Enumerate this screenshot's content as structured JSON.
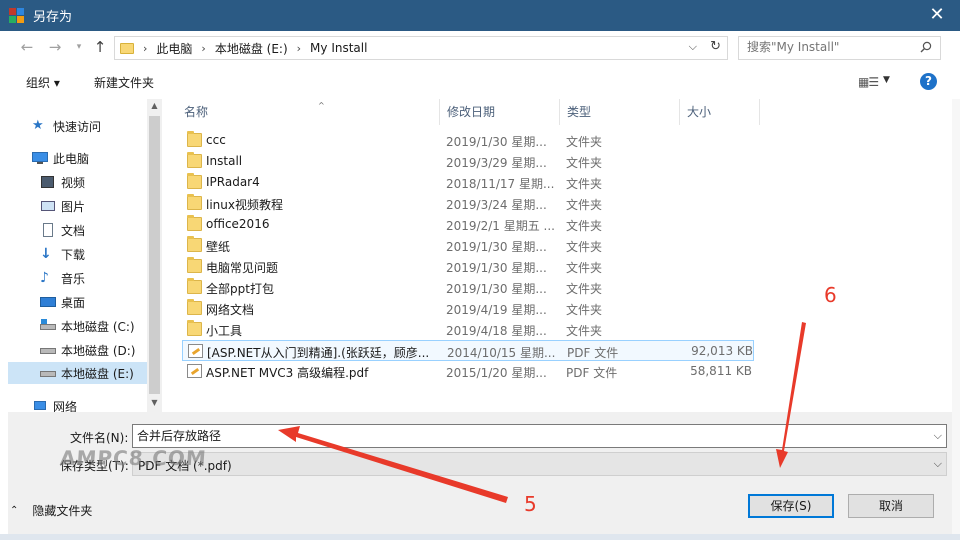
{
  "window": {
    "title": "另存为"
  },
  "address": {
    "crumbs": [
      "此电脑",
      "本地磁盘 (E:)",
      "My Install"
    ],
    "search_placeholder": "搜索\"My Install\""
  },
  "toolbar": {
    "organize": "组织 ▾",
    "new_folder": "新建文件夹"
  },
  "nav": {
    "items": [
      {
        "label": "快速访问",
        "icon": "star-icon"
      },
      {
        "label": "此电脑",
        "icon": "computer-icon"
      },
      {
        "label": "视频",
        "icon": "video-icon"
      },
      {
        "label": "图片",
        "icon": "picture-icon"
      },
      {
        "label": "文档",
        "icon": "document-icon"
      },
      {
        "label": "下载",
        "icon": "download-icon"
      },
      {
        "label": "音乐",
        "icon": "music-icon"
      },
      {
        "label": "桌面",
        "icon": "desktop-icon"
      },
      {
        "label": "本地磁盘 (C:)",
        "icon": "drive-icon"
      },
      {
        "label": "本地磁盘 (D:)",
        "icon": "drive-icon"
      },
      {
        "label": "本地磁盘 (E:)",
        "icon": "drive-icon"
      },
      {
        "label": "网络",
        "icon": "network-icon"
      }
    ]
  },
  "columns": {
    "name": "名称",
    "date": "修改日期",
    "type": "类型",
    "size": "大小"
  },
  "files": [
    {
      "name": "ccc",
      "date": "2019/1/30 星期...",
      "type": "文件夹",
      "size": "",
      "kind": "folder"
    },
    {
      "name": "Install",
      "date": "2019/3/29 星期...",
      "type": "文件夹",
      "size": "",
      "kind": "folder"
    },
    {
      "name": "IPRadar4",
      "date": "2018/11/17 星期...",
      "type": "文件夹",
      "size": "",
      "kind": "folder"
    },
    {
      "name": "linux视频教程",
      "date": "2019/3/24 星期...",
      "type": "文件夹",
      "size": "",
      "kind": "folder"
    },
    {
      "name": "office2016",
      "date": "2019/2/1 星期五 ...",
      "type": "文件夹",
      "size": "",
      "kind": "folder"
    },
    {
      "name": "壁纸",
      "date": "2019/1/30 星期...",
      "type": "文件夹",
      "size": "",
      "kind": "folder"
    },
    {
      "name": "电脑常见问题",
      "date": "2019/1/30 星期...",
      "type": "文件夹",
      "size": "",
      "kind": "folder"
    },
    {
      "name": "全部ppt打包",
      "date": "2019/1/30 星期...",
      "type": "文件夹",
      "size": "",
      "kind": "folder"
    },
    {
      "name": "网络文档",
      "date": "2019/4/19 星期...",
      "type": "文件夹",
      "size": "",
      "kind": "folder"
    },
    {
      "name": "小工具",
      "date": "2019/4/18 星期...",
      "type": "文件夹",
      "size": "",
      "kind": "folder"
    },
    {
      "name": "[ASP.NET从入门到精通].(张跃廷，顾彦...",
      "date": "2014/10/15 星期...",
      "type": "PDF 文件",
      "size": "92,013 KB",
      "kind": "pdf"
    },
    {
      "name": "ASP.NET MVC3 高级编程.pdf",
      "date": "2015/1/20 星期...",
      "type": "PDF 文件",
      "size": "58,811 KB",
      "kind": "pdf"
    }
  ],
  "form": {
    "filename_label": "文件名(N):",
    "filename_value": "合并后存放路径",
    "filetype_label": "保存类型(T):",
    "filetype_value": "PDF 文档 (*.pdf)"
  },
  "footer": {
    "hide_folders": "隐藏文件夹",
    "save": "保存(S)",
    "cancel": "取消"
  },
  "watermark": "AMPC8.COM",
  "annotations": {
    "step5": "5",
    "step6": "6",
    "color": "#e83a2a"
  }
}
